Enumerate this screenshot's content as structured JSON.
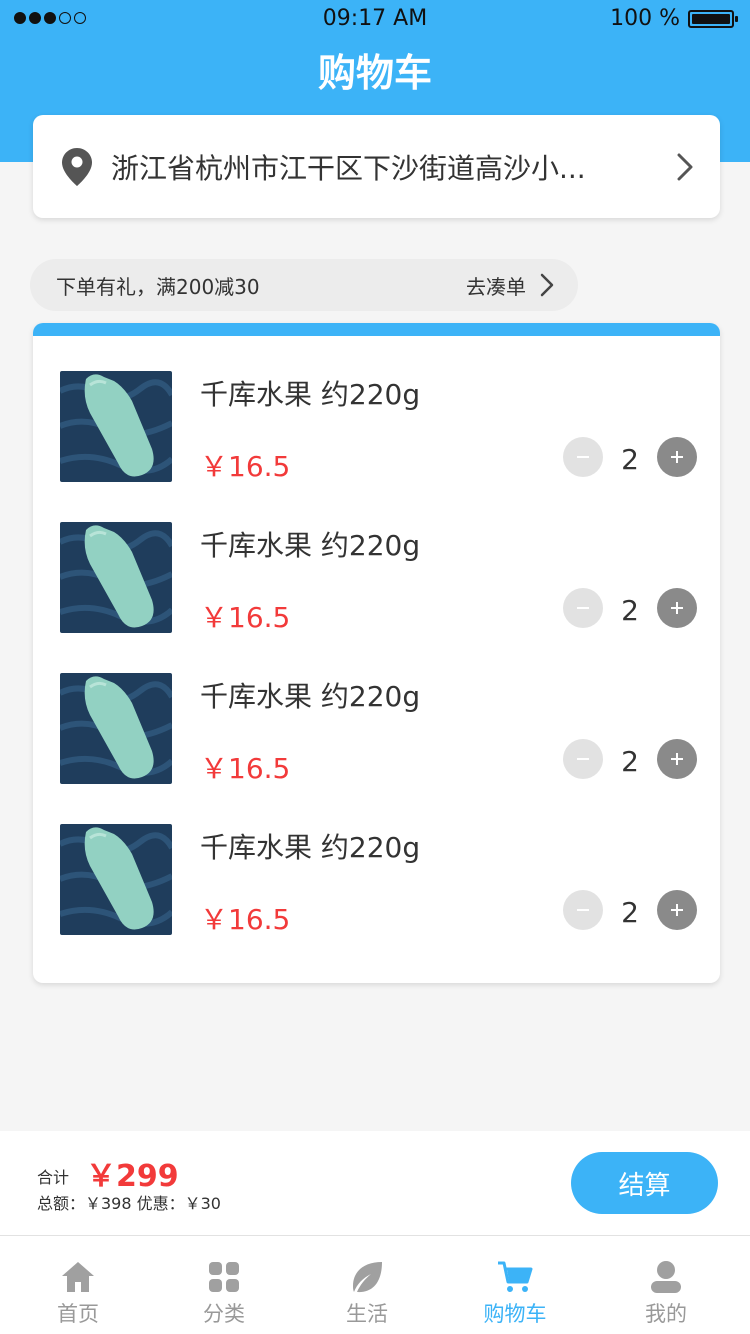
{
  "status_bar": {
    "time": "09:17 AM",
    "battery": "100 %"
  },
  "header": {
    "title": "购物车"
  },
  "address": {
    "text": "浙江省杭州市江干区下沙街道高沙小..."
  },
  "promo": {
    "text": "下单有礼，满200减30",
    "link_label": "去凑单"
  },
  "cart": {
    "items": [
      {
        "name": "千库水果 约220g",
        "price": "￥16.5",
        "quantity": "2"
      },
      {
        "name": "千库水果 约220g",
        "price": "￥16.5",
        "quantity": "2"
      },
      {
        "name": "千库水果 约220g",
        "price": "￥16.5",
        "quantity": "2"
      },
      {
        "name": "千库水果 约220g",
        "price": "￥16.5",
        "quantity": "2"
      }
    ]
  },
  "checkout": {
    "total_label": "合计",
    "total_value": "￥299",
    "detail": "总额：￥398 优惠：￥30",
    "button_label": "结算"
  },
  "tabbar": {
    "items": [
      {
        "label": "首页",
        "icon": "home-icon"
      },
      {
        "label": "分类",
        "icon": "grid-icon"
      },
      {
        "label": "生活",
        "icon": "leaf-icon"
      },
      {
        "label": "购物车",
        "icon": "cart-icon",
        "active": true
      },
      {
        "label": "我的",
        "icon": "user-icon"
      }
    ]
  },
  "colors": {
    "primary": "#3cb3f7",
    "price": "#f23a3a",
    "background": "#f5f5f5"
  }
}
